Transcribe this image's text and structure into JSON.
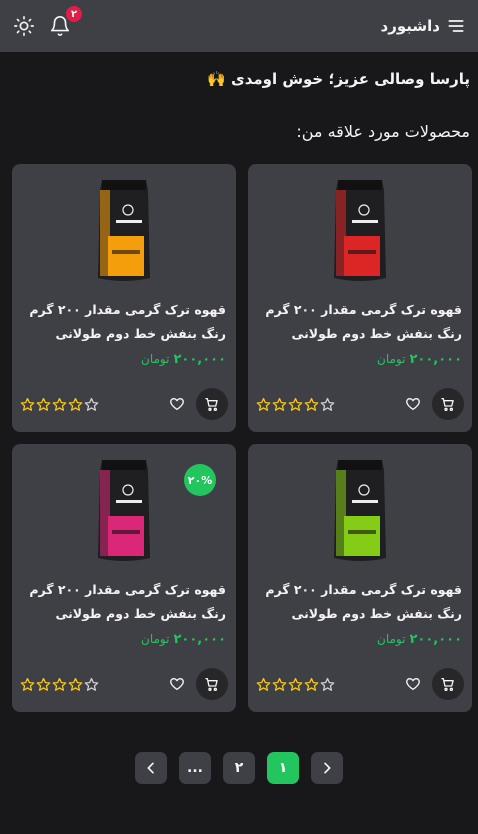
{
  "header": {
    "title": "داشبورد",
    "notification_count": "۲"
  },
  "greeting": "پارسا وصالی عزیز؛ خوش اومدی 🙌",
  "section_title": "محصولات مورد علاقه من:",
  "products": [
    {
      "title": "قهوه ترک گرمی مقدار ۲۰۰ گرم رنگ بنفش خط دوم طولانی",
      "price": "۲۰۰,۰۰۰",
      "currency": "تومان",
      "color": "#dc2626",
      "rating": 4,
      "discount": ""
    },
    {
      "title": "قهوه ترک گرمی مقدار ۲۰۰ گرم رنگ بنفش خط دوم طولانی",
      "price": "۲۰۰,۰۰۰",
      "currency": "تومان",
      "color": "#f59e0b",
      "rating": 4,
      "discount": ""
    },
    {
      "title": "قهوه ترک گرمی مقدار ۲۰۰ گرم رنگ بنفش خط دوم طولانی",
      "price": "۲۰۰,۰۰۰",
      "currency": "تومان",
      "color": "#84cc16",
      "rating": 4,
      "discount": ""
    },
    {
      "title": "قهوه ترک گرمی مقدار ۲۰۰ گرم رنگ بنفش خط دوم طولانی",
      "price": "۲۰۰,۰۰۰",
      "currency": "تومان",
      "color": "#db2777",
      "rating": 4,
      "discount": "۲۰%"
    }
  ],
  "pagination": {
    "pages": [
      "۱",
      "۲",
      "..."
    ],
    "active": "۱"
  },
  "colors": {
    "accent": "#22c55e",
    "star": "#facc15",
    "badge": "#e11d48",
    "card_bg": "#3f3f46",
    "page_bg": "#18181b"
  },
  "icons": [
    "hamburger-icon",
    "bell-icon",
    "sun-icon",
    "cart-icon",
    "heart-icon",
    "star-icon",
    "chevron-right-icon",
    "chevron-left-icon"
  ]
}
